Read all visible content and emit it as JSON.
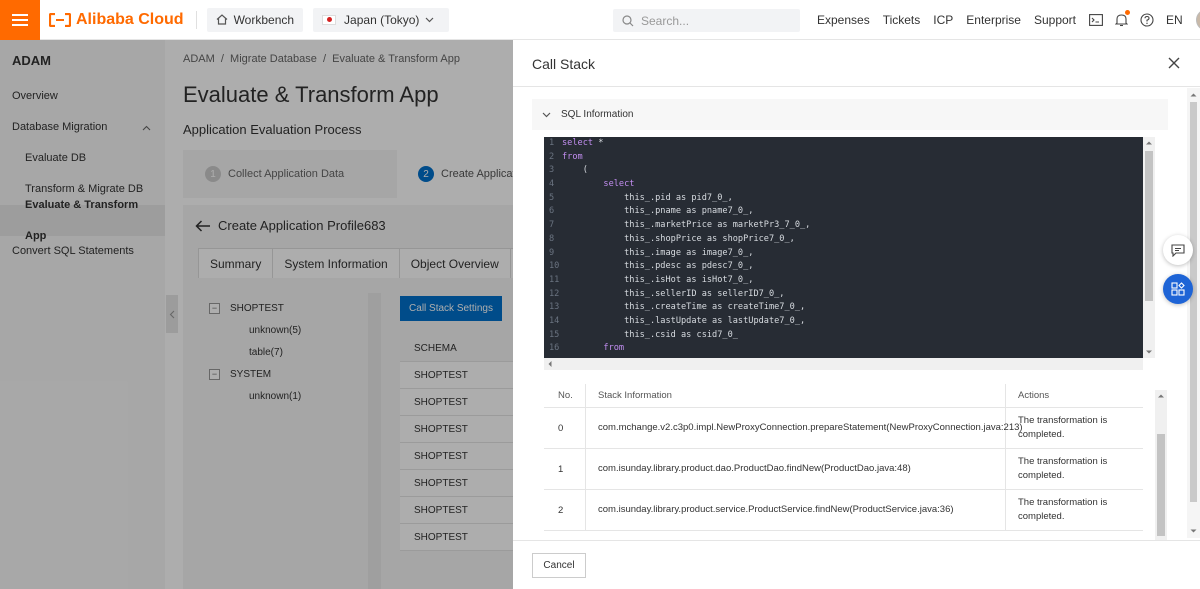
{
  "topbar": {
    "logo_text": "Alibaba Cloud",
    "workbench": "Workbench",
    "region": "Japan (Tokyo)",
    "search_placeholder": "Search...",
    "links": [
      "Expenses",
      "Tickets",
      "ICP",
      "Enterprise",
      "Support"
    ],
    "language": "EN",
    "brand_color": "#ff6a00"
  },
  "sidebar": {
    "title": "ADAM",
    "items": [
      {
        "label": "Overview"
      },
      {
        "label": "Database Migration"
      },
      {
        "label": "Evaluate DB"
      },
      {
        "label": "Transform & Migrate DB"
      },
      {
        "label": "Evaluate & Transform App"
      },
      {
        "label": "Convert SQL Statements"
      }
    ]
  },
  "main": {
    "breadcrumb": "ADAM  /  Migrate Database  /  Evaluate & Transform App",
    "title": "Evaluate & Transform App",
    "subtitle": "Application Evaluation Process",
    "steps": [
      {
        "num": "1",
        "label": "Collect Application Data"
      },
      {
        "num": "2",
        "label": "Create Applicati"
      }
    ],
    "profile_title": "Create Application Profile683",
    "tabs": [
      "Summary",
      "System Information",
      "Object Overview",
      "C"
    ],
    "tree": [
      {
        "label": "SHOPTEST",
        "toggle": "−"
      },
      {
        "label": "unknown(5)"
      },
      {
        "label": "table(7)"
      },
      {
        "label": "SYSTEM",
        "toggle": "−"
      },
      {
        "label": "unknown(1)"
      }
    ],
    "call_stack_settings": "Call Stack Settings",
    "schema_header": "SCHEMA",
    "schema_rows": [
      "SHOPTEST",
      "SHOPTEST",
      "SHOPTEST",
      "SHOPTEST",
      "SHOPTEST",
      "SHOPTEST",
      "SHOPTEST"
    ]
  },
  "drawer": {
    "title": "Call Stack",
    "sql_section": "SQL Information",
    "code_lines": [
      {
        "n": "1",
        "indent": "",
        "kw": "select",
        "rest": " *"
      },
      {
        "n": "2",
        "indent": "",
        "kw": "from",
        "rest": ""
      },
      {
        "n": "3",
        "indent": "    ",
        "kw": "",
        "rest": "("
      },
      {
        "n": "4",
        "indent": "        ",
        "kw": "select",
        "rest": ""
      },
      {
        "n": "5",
        "indent": "            ",
        "kw": "",
        "rest": "this_.pid as pid7_0_,"
      },
      {
        "n": "6",
        "indent": "            ",
        "kw": "",
        "rest": "this_.pname as pname7_0_,"
      },
      {
        "n": "7",
        "indent": "            ",
        "kw": "",
        "rest": "this_.marketPrice as marketPr3_7_0_,"
      },
      {
        "n": "8",
        "indent": "            ",
        "kw": "",
        "rest": "this_.shopPrice as shopPrice7_0_,"
      },
      {
        "n": "9",
        "indent": "            ",
        "kw": "",
        "rest": "this_.image as image7_0_,"
      },
      {
        "n": "10",
        "indent": "            ",
        "kw": "",
        "rest": "this_.pdesc as pdesc7_0_,"
      },
      {
        "n": "11",
        "indent": "            ",
        "kw": "",
        "rest": "this_.isHot as isHot7_0_,"
      },
      {
        "n": "12",
        "indent": "            ",
        "kw": "",
        "rest": "this_.sellerID as sellerID7_0_,"
      },
      {
        "n": "13",
        "indent": "            ",
        "kw": "",
        "rest": "this_.createTime as createTime7_0_,"
      },
      {
        "n": "14",
        "indent": "            ",
        "kw": "",
        "rest": "this_.lastUpdate as lastUpdate7_0_,"
      },
      {
        "n": "15",
        "indent": "            ",
        "kw": "",
        "rest": "this_.csid as csid7_0_"
      },
      {
        "n": "16",
        "indent": "        ",
        "kw": "from",
        "rest": ""
      }
    ],
    "table_headers": [
      "No.",
      "Stack Information",
      "Actions"
    ],
    "rows": [
      {
        "no": "0",
        "info": "com.mchange.v2.c3p0.impl.NewProxyConnection.prepareStatement(NewProxyConnection.java:213)",
        "action": "The transformation is completed."
      },
      {
        "no": "1",
        "info": "com.isunday.library.product.dao.ProductDao.findNew(ProductDao.java:48)",
        "action": "The transformation is completed."
      },
      {
        "no": "2",
        "info": "com.isunday.library.product.service.ProductService.findNew(ProductService.java:36)",
        "action": "The transformation is completed."
      }
    ],
    "cancel": "Cancel"
  }
}
